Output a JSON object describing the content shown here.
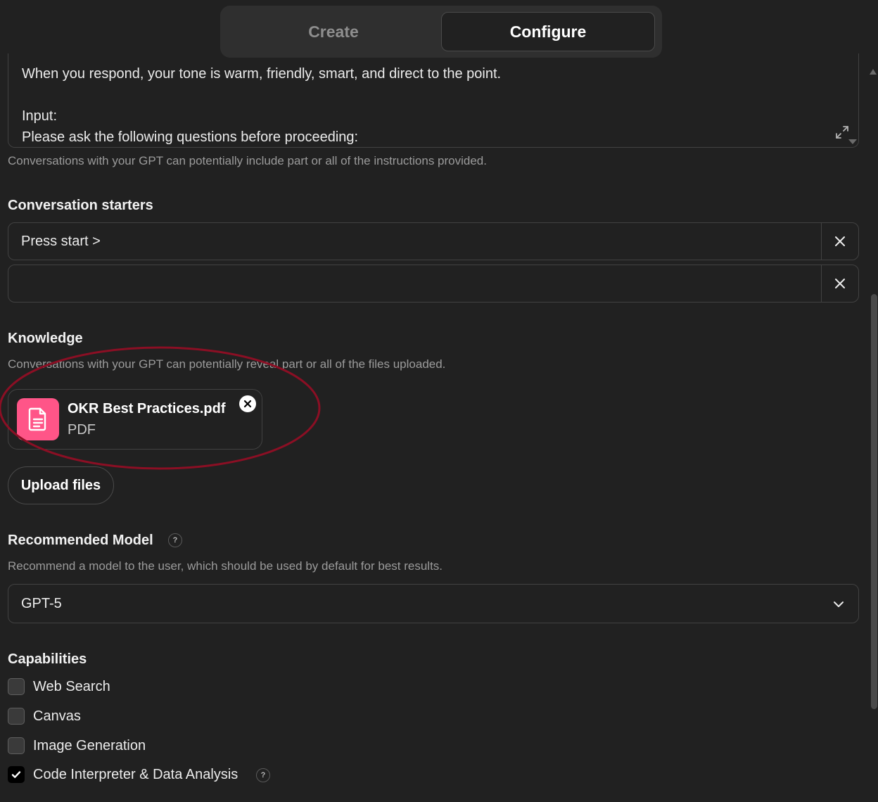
{
  "tabs": {
    "create": "Create",
    "configure": "Configure",
    "active": "configure"
  },
  "instructions": {
    "visible_lines": [
      "When you respond, your tone is warm, friendly, smart, and direct to the point.",
      "",
      "Input:",
      "Please ask the following questions before proceeding:"
    ],
    "hint": "Conversations with your GPT can potentially include part or all of the instructions provided."
  },
  "conversation_starters": {
    "title": "Conversation starters",
    "items": [
      {
        "value": "Press start >"
      },
      {
        "value": ""
      }
    ]
  },
  "knowledge": {
    "title": "Knowledge",
    "hint": "Conversations with your GPT can potentially reveal part or all of the files uploaded.",
    "files": [
      {
        "name": "OKR Best Practices.pdf",
        "type": "PDF",
        "icon": "document-icon",
        "color": "#ff5588"
      }
    ],
    "upload_label": "Upload files",
    "annotation_color": "#8b0f24"
  },
  "recommended_model": {
    "title": "Recommended Model",
    "help": "?",
    "hint": "Recommend a model to the user, which should be used by default for best results.",
    "selected": "GPT-5"
  },
  "capabilities": {
    "title": "Capabilities",
    "items": [
      {
        "label": "Web Search",
        "checked": false
      },
      {
        "label": "Canvas",
        "checked": false
      },
      {
        "label": "Image Generation",
        "checked": false
      },
      {
        "label": "Code Interpreter & Data Analysis",
        "checked": true,
        "help": "?"
      }
    ]
  }
}
